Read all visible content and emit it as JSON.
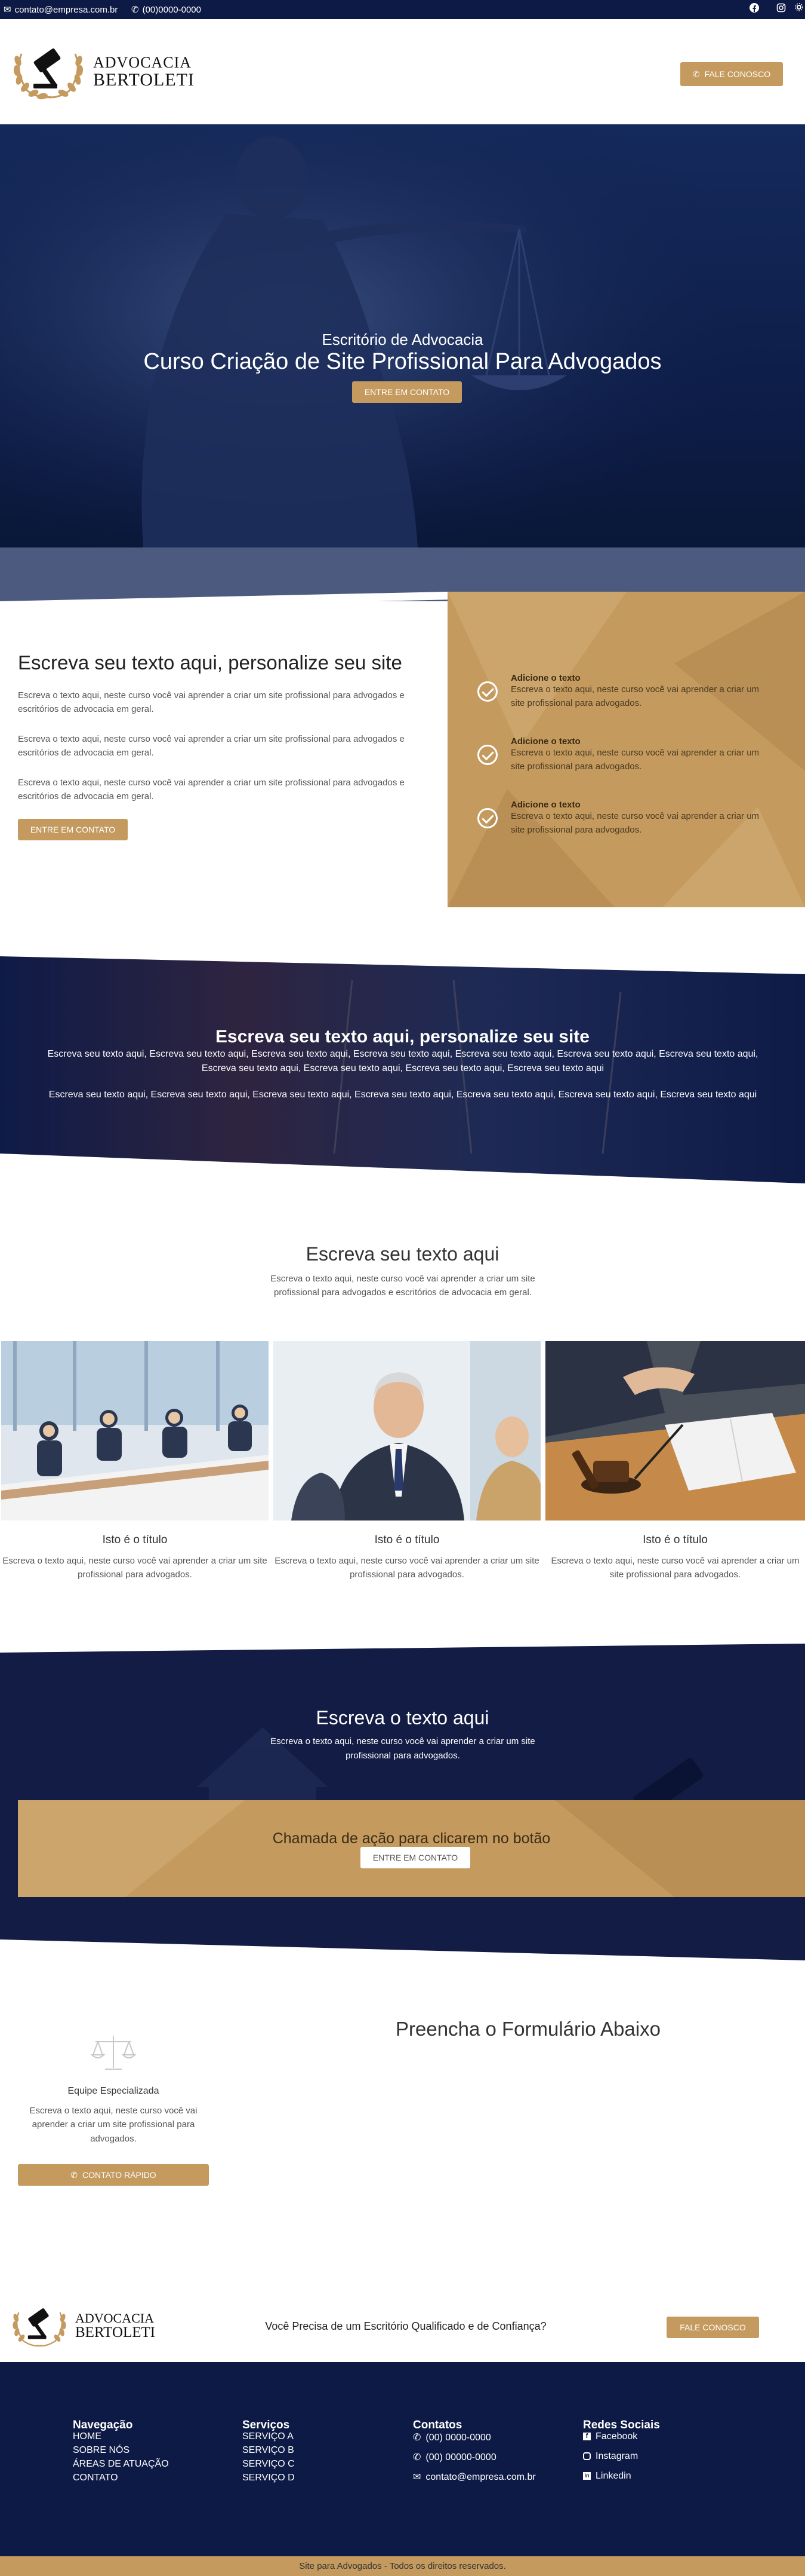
{
  "topbar": {
    "email": "contato@empresa.com.br",
    "phone": "(00)0000-0000",
    "social_icons": [
      "facebook-icon",
      "instagram-icon"
    ]
  },
  "header": {
    "logo_line1": "ADVOCACIA",
    "logo_line2": "BERTOLETI",
    "cta_label": "FALE CONOSCO"
  },
  "hero": {
    "eyebrow": "Escritório de Advocacia",
    "title": "Curso Criação de Site Profissional Para Advogados",
    "cta_label": "ENTRE EM CONTATO"
  },
  "intro": {
    "title": "Escreva seu texto aqui, personalize seu site",
    "paragraphs": [
      "Escreva o texto aqui, neste curso você vai aprender a criar um site profissional para advogados e escritórios de advocacia em geral.",
      "Escreva o texto aqui, neste curso você vai aprender a criar um site profissional para advogados e escritórios de advocacia em geral.",
      "Escreva o texto aqui, neste curso você vai aprender a criar um site profissional para advogados e escritórios de advocacia em geral."
    ],
    "cta_label": "ENTRE EM CONTATO",
    "features": [
      {
        "title": "Adicione o texto",
        "text": "Escreva o texto aqui, neste curso você vai aprender a criar um site profissional para advogados."
      },
      {
        "title": "Adicione o texto",
        "text": "Escreva o texto aqui, neste curso você vai aprender a criar um site profissional para advogados."
      },
      {
        "title": "Adicione o texto",
        "text": "Escreva o texto aqui, neste curso você vai aprender a criar um site profissional para advogados."
      }
    ]
  },
  "banner": {
    "title": "Escreva seu texto aqui, personalize seu site",
    "line1": "Escreva seu texto aqui, Escreva seu texto aqui, Escreva seu texto aqui, Escreva seu texto aqui, Escreva seu texto aqui, Escreva seu texto aqui, Escreva seu texto aqui,",
    "line2": "Escreva seu texto aqui, Escreva seu texto aqui, Escreva seu texto aqui, Escreva seu texto aqui",
    "line3": "Escreva seu texto aqui, Escreva seu texto aqui, Escreva seu texto aqui, Escreva seu texto aqui, Escreva seu texto aqui, Escreva seu texto aqui, Escreva seu texto aqui"
  },
  "services": {
    "title": "Escreva seu texto aqui",
    "subtitle": "Escreva o texto aqui, neste curso você vai aprender a criar um site profissional para advogados e escritórios de advocacia em geral.",
    "items": [
      {
        "title": "Isto é o título",
        "text": "Escreva o texto aqui, neste curso você vai aprender a criar um site profissional para advogados."
      },
      {
        "title": "Isto é o título",
        "text": "Escreva o texto aqui, neste curso você vai aprender a criar um site profissional para advogados."
      },
      {
        "title": "Isto é o título",
        "text": "Escreva o texto aqui, neste curso você vai aprender a criar um site profissional para advogados."
      }
    ]
  },
  "cta_section": {
    "title": "Escreva o texto aqui",
    "text": "Escreva o texto aqui, neste curso você vai aprender a criar um site profissional para advogados.",
    "box_title": "Chamada de ação para clicarem no botão",
    "box_cta": "ENTRE EM CONTATO"
  },
  "contact": {
    "team_title": "Equipe Especializada",
    "team_text": "Escreva o texto aqui, neste curso você vai aprender a criar um site profissional para advogados.",
    "quick_cta": "CONTATO RÁPIDO",
    "form_title": "Preencha o Formulário Abaixo"
  },
  "pre_footer": {
    "logo_line1": "ADVOCACIA",
    "logo_line2": "BERTOLETI",
    "tagline": "Você  Precisa de um Escritório Qualificado e de Confiança?",
    "cta_label": "FALE CONOSCO"
  },
  "footer": {
    "nav_title": "Navegação",
    "nav": [
      "HOME",
      "SOBRE NÓS",
      "ÁREAS DE ATUAÇÃO",
      "CONTATO"
    ],
    "svc_title": "Serviços",
    "services": [
      "SERVIÇO A",
      "SERVIÇO B",
      "SERVIÇO C",
      "SERVIÇO D"
    ],
    "contacts_title": "Contatos",
    "contacts": [
      "(00) 0000-0000",
      "(00) 00000-0000",
      "contato@empresa.com.br"
    ],
    "social_title": "Redes Sociais",
    "social": [
      "Facebook",
      "Instagram",
      "Linkedin"
    ],
    "copyright": "Site para Advogados - Todos os direitos reservados."
  },
  "colors": {
    "navy": "#0d1a45",
    "gold": "#c49a5f",
    "band": "#4b5a7e"
  }
}
